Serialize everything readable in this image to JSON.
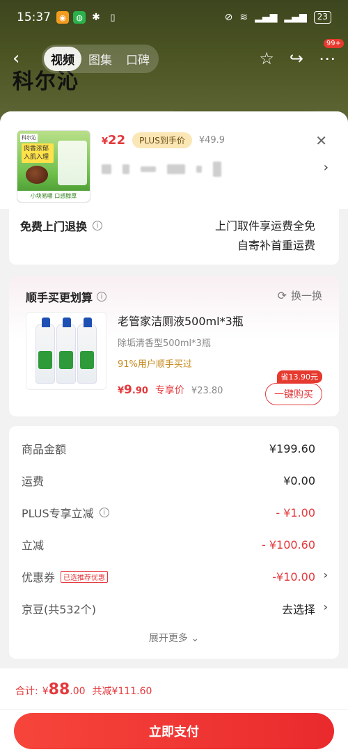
{
  "status_bar": {
    "time": "15:37",
    "battery": "23"
  },
  "nav": {
    "back_icon": "back-arrow-icon",
    "tabs": [
      "视频",
      "图集",
      "口碑"
    ],
    "badge": "99+"
  },
  "product": {
    "image_tag": "科尔沁",
    "image_slogan": "肉香浓郁 入肌入理",
    "image_bottom": "小块易嚼 口感醇厚",
    "price_symbol": "¥",
    "price": "22",
    "plus_label": "PLUS到手价",
    "original_price": "¥49.9"
  },
  "free_return": {
    "title": "免费上门退换",
    "line1": "上门取件享运费全免",
    "line2": "自寄补首重运费"
  },
  "addon": {
    "title": "顺手买更划算",
    "swap_label": "换一换",
    "name": "老管家洁厕液500ml*3瓶",
    "spec": "除垢清香型500ml*3瓶",
    "buyers": "91%用户顺手买过",
    "price_symbol": "¥",
    "price_int": "9",
    "price_dec": ".90",
    "exclusive": "专享价",
    "original_price": "¥23.80",
    "save_badge": "省13.90元",
    "buy_label": "一键购买"
  },
  "summary": {
    "rows": [
      {
        "label": "商品金额",
        "value": "¥199.60"
      },
      {
        "label": "运费",
        "value": "¥0.00"
      },
      {
        "label": "PLUS专享立减",
        "value": "- ¥1.00"
      },
      {
        "label": "立减",
        "value": "- ¥100.60"
      },
      {
        "label": "优惠券",
        "value": "-¥10.00",
        "tag": "已选推荐优惠"
      },
      {
        "label": "京豆(共532个)",
        "value": "去选择"
      }
    ],
    "expand_label": "展开更多"
  },
  "footer": {
    "total_label": "合计:",
    "total_symbol": "¥",
    "total_int": "88",
    "total_dec": ".00",
    "saved": "共减¥111.60",
    "pay_label": "立即支付"
  },
  "colors": {
    "accent": "#e4393c",
    "gold": "#c58a1e",
    "plus_bg": "#fbe7b5"
  }
}
